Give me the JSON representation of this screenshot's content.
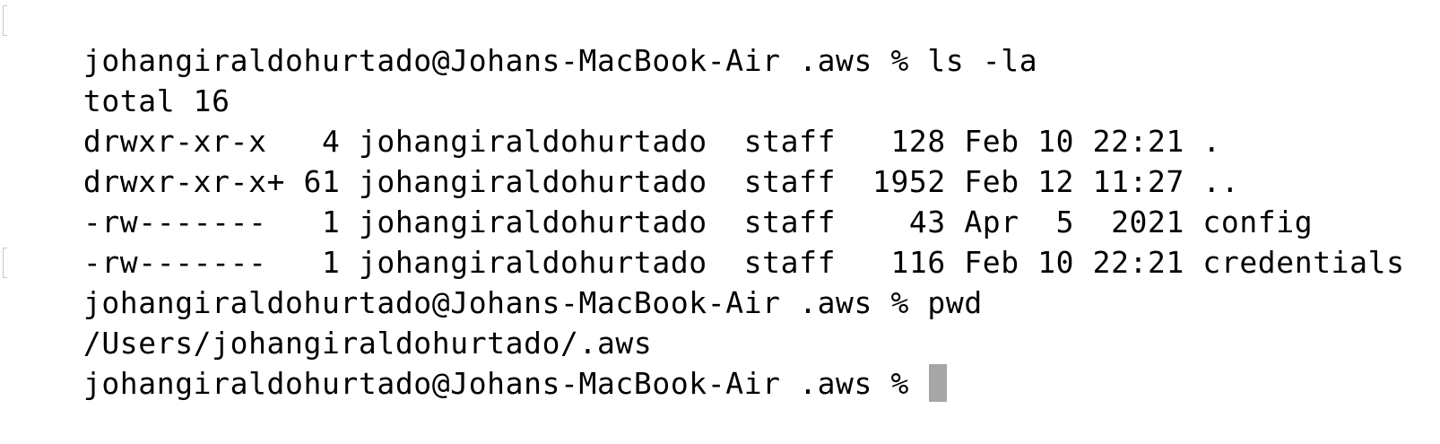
{
  "terminal": {
    "lines": [
      {
        "text": "johangiraldohurtado@Johans-MacBook-Air .aws % ls -la",
        "is_prompt": true
      },
      {
        "text": "total 16",
        "is_prompt": false
      },
      {
        "text": "drwxr-xr-x   4 johangiraldohurtado  staff   128 Feb 10 22:21 .",
        "is_prompt": false
      },
      {
        "text": "drwxr-xr-x+ 61 johangiraldohurtado  staff  1952 Feb 12 11:27 ..",
        "is_prompt": false
      },
      {
        "text": "-rw-------   1 johangiraldohurtado  staff    43 Apr  5  2021 config",
        "is_prompt": false
      },
      {
        "text": "-rw-------   1 johangiraldohurtado  staff   116 Feb 10 22:21 credentials",
        "is_prompt": false
      },
      {
        "text": "johangiraldohurtado@Johans-MacBook-Air .aws % pwd",
        "is_prompt": true
      },
      {
        "text": "/Users/johangiraldohurtado/.aws",
        "is_prompt": false
      }
    ],
    "current_prompt": "johangiraldohurtado@Johans-MacBook-Air .aws % ",
    "colors": {
      "background": "#ffffff",
      "text": "#000000",
      "cursor": "#a6a6a6"
    }
  }
}
